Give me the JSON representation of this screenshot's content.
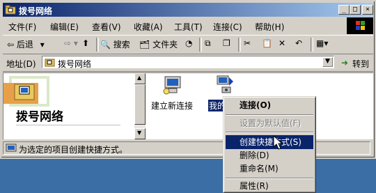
{
  "window": {
    "title": "拨号网络",
    "controls": {
      "minimize": "_",
      "maximize": "□",
      "close": "×"
    }
  },
  "menu": [
    "文件(F)",
    "编辑(E)",
    "查看(V)",
    "收藏(A)",
    "工具(T)",
    "连接(C)",
    "帮助(H)"
  ],
  "toolbar": {
    "back": "后退",
    "search": "搜索",
    "folders": "文件夹"
  },
  "address": {
    "label": "地址(D)",
    "value": "拨号网络",
    "go": "转到"
  },
  "left_panel": {
    "title": "拨号网络"
  },
  "items": [
    {
      "label": "建立新连接"
    },
    {
      "label": "我的连接"
    }
  ],
  "status": {
    "text": "为选定的项目创建快捷方式。"
  },
  "context_menu": {
    "items": [
      {
        "label": "连接(O)",
        "style": "bold"
      },
      {
        "label": "设置为默认值(F)",
        "style": "disabled"
      },
      {
        "label": "创建快捷方式(S)",
        "style": "highlighted"
      },
      {
        "label": "删除(D)",
        "style": "normal"
      },
      {
        "label": "重命名(M)",
        "style": "normal"
      },
      {
        "label": "属性(R)",
        "style": "normal"
      }
    ]
  },
  "colors": {
    "desktop": "#3a6ea5",
    "title_start": "#0a246a",
    "title_end": "#a6caf0",
    "face": "#d4d0c8",
    "highlight": "#0a246a"
  }
}
